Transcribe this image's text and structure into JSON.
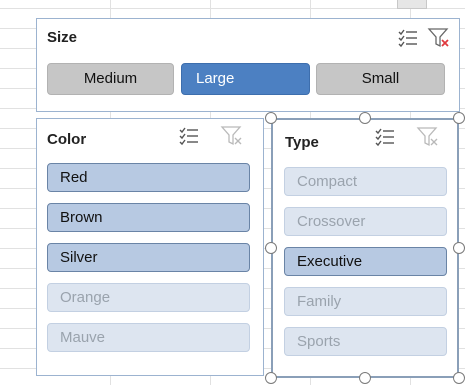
{
  "size_slicer": {
    "title": "Size",
    "multiselect_icon": "multi-select-icon",
    "clear_filter_icon": "clear-filter-icon",
    "items": [
      {
        "label": "Medium",
        "state": "gray"
      },
      {
        "label": "Large",
        "state": "selected"
      },
      {
        "label": "Small",
        "state": "gray"
      }
    ]
  },
  "color_slicer": {
    "title": "Color",
    "multiselect_icon": "multi-select-icon",
    "clear_filter_icon": "clear-filter-icon",
    "items": [
      {
        "label": "Red",
        "state": "selected"
      },
      {
        "label": "Brown",
        "state": "selected"
      },
      {
        "label": "Silver",
        "state": "selected"
      },
      {
        "label": "Orange",
        "state": "no-data"
      },
      {
        "label": "Mauve",
        "state": "no-data"
      }
    ]
  },
  "type_slicer": {
    "title": "Type",
    "multiselect_icon": "multi-select-icon",
    "clear_filter_icon": "clear-filter-icon",
    "items": [
      {
        "label": "Compact",
        "state": "no-data"
      },
      {
        "label": "Crossover",
        "state": "no-data"
      },
      {
        "label": "Executive",
        "state": "selected"
      },
      {
        "label": "Family",
        "state": "no-data"
      },
      {
        "label": "Sports",
        "state": "no-data"
      }
    ]
  },
  "colors": {
    "slicer_border": "#9cb3d0",
    "selected_item": "#b7c9e2",
    "selected_border": "#6a84a6",
    "active_button": "#4c80c2",
    "gray_button": "#c6c6c6",
    "no_data_item": "#dde5f0",
    "no_data_text": "#9aa3ad",
    "clear_filter_x": "#e0393e"
  }
}
